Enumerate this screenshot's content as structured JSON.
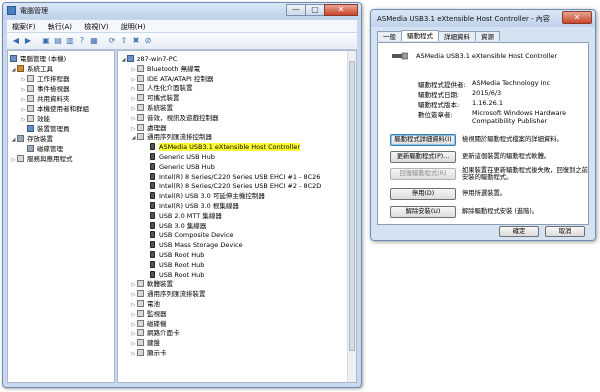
{
  "main_window": {
    "title": "電腦管理",
    "window_buttons": [
      "—",
      "▢",
      "✕"
    ],
    "menu": [
      "檔案(F)",
      "執行(A)",
      "檢視(V)",
      "說明(H)"
    ],
    "toolbar_icons": [
      "back-icon",
      "forward-icon",
      "up-icon",
      "view-icon",
      "properties-icon",
      "help-icon",
      "refresh-icon",
      "scan-icon",
      "update-driver-icon",
      "uninstall-icon",
      "disable-icon"
    ],
    "left_tree": [
      {
        "label": "電腦管理 (本機)",
        "icon": "computer-icon"
      },
      {
        "label": "系統工具",
        "icon": "tools-icon"
      },
      {
        "label": "工作排程器",
        "icon": "clock-icon"
      },
      {
        "label": "事件檢視器",
        "icon": "event-icon"
      },
      {
        "label": "共用資料夾",
        "icon": "folder-icon"
      },
      {
        "label": "本機使用者和群組",
        "icon": "users-icon"
      },
      {
        "label": "效能",
        "icon": "performance-icon"
      },
      {
        "label": "裝置管理員",
        "icon": "device-manager-icon"
      },
      {
        "label": "存放裝置",
        "icon": "storage-icon"
      },
      {
        "label": "磁碟管理",
        "icon": "disk-icon"
      },
      {
        "label": "服務與應用程式",
        "icon": "services-icon"
      }
    ],
    "device_tree": {
      "root": "z87-win7-PC",
      "categories": [
        "Bluetooth 無線電",
        "IDE ATA/ATAPI 控制器",
        "人性化介面裝置",
        "可攜式裝置",
        "系統裝置",
        "音效，視訊及遊戲控制器",
        "處理器",
        "通用序列匯流排控制器"
      ],
      "usb_devices": [
        "ASMedia USB3.1 eXtensible Host Controller",
        "Generic USB Hub",
        "Generic USB Hub",
        "Intel(R) 8 Series/C220 Series USB EHCI #1 - 8C26",
        "Intel(R) 8 Series/C220 Series USB EHCI #2 - 8C2D",
        "Intel(R) USB 3.0 可延伸主機控制器",
        "Intel(R) USB 3.0 根集線器",
        "USB 2.0 MTT 集線器",
        "USB 3.0 集線器",
        "USB Composite Device",
        "USB Mass Storage Device",
        "USB Root Hub",
        "USB Root Hub",
        "USB Root Hub"
      ],
      "after_categories": [
        "軟體裝置",
        "通用序列匯流排裝置",
        "電池",
        "監視器",
        "磁碟機",
        "網路介面卡",
        "鍵盤",
        "顯示卡"
      ]
    },
    "highlight_color": "#ffff33"
  },
  "dialog": {
    "title": "ASMedia USB3.1 eXtensible Host Controller - 內容",
    "close_symbol": "✕",
    "tabs": [
      "一般",
      "驅動程式",
      "詳細資料",
      "資源"
    ],
    "active_tab": "驅動程式",
    "device_name": "ASMedia USB3.1 eXtensible Host Controller",
    "properties": [
      {
        "label": "驅動程式提供者:",
        "value": "ASMedia Technology Inc"
      },
      {
        "label": "驅動程式日期:",
        "value": "2015/6/3"
      },
      {
        "label": "驅動程式版本:",
        "value": "1.16.26.1"
      },
      {
        "label": "數位簽章者:",
        "value": "Microsoft Windows Hardware Compatibility Publisher"
      }
    ],
    "actions": [
      {
        "button": "驅動程式詳細資料(I)",
        "desc": "檢視關於驅動程式檔案的詳細資料。"
      },
      {
        "button": "更新驅動程式(P)...",
        "desc": "更新這個裝置的驅動程式軟體。"
      },
      {
        "button": "回復驅動程式(R)",
        "desc": "如果裝置在更新驅動程式後失敗，回復到之前安裝的驅動程式。"
      },
      {
        "button": "停用(D)",
        "desc": "停用所選裝置。"
      },
      {
        "button": "解除安裝(U)",
        "desc": "解除驅動程式安裝 (進階)。"
      }
    ],
    "ok_label": "確定",
    "cancel_label": "取消"
  }
}
